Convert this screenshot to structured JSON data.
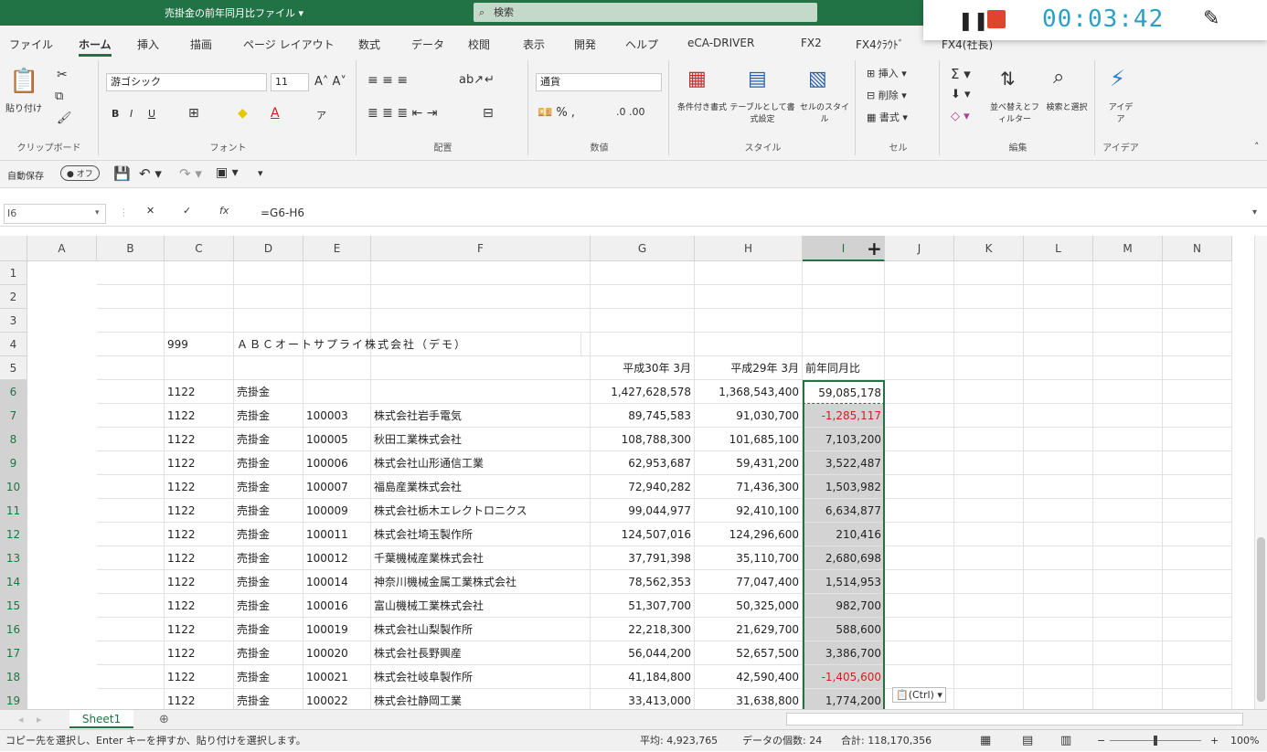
{
  "titlebar": {
    "doc_title": "売掛金の前年同月比ファイル ▾",
    "search_placeholder": "検索"
  },
  "recorder": {
    "timer": "00:03:42"
  },
  "menu": [
    "ファイル",
    "ホーム",
    "挿入",
    "描画",
    "ページ レイアウト",
    "数式",
    "データ",
    "校閲",
    "表示",
    "開発",
    "ヘルプ",
    "eCA-DRIVER",
    "FX2",
    "FX4ｸﾗｳﾄﾞ",
    "FX4(社長)"
  ],
  "ribbon": {
    "paste": "貼り付け",
    "font_name": "游ゴシック",
    "font_size": "11",
    "number_format": "通貨",
    "cond_format": "条件付き書式",
    "table_format": "テーブルとして書式設定",
    "cell_style": "セルのスタイル",
    "insert": "挿入",
    "delete": "削除",
    "format": "書式",
    "sort_filter": "並べ替えとフィルター",
    "find_select": "検索と選択",
    "ideas": "アイデア",
    "groups": [
      "クリップボード",
      "フォント",
      "配置",
      "数値",
      "スタイル",
      "セル",
      "編集",
      "アイデア"
    ]
  },
  "qat": {
    "autosave_label": "自動保存",
    "autosave_state": "オフ"
  },
  "formula_bar": {
    "name_box": "I6",
    "formula": "=G6-H6"
  },
  "columns": [
    "A",
    "B",
    "C",
    "D",
    "E",
    "F",
    "G",
    "H",
    "I",
    "J",
    "K",
    "L",
    "M",
    "N"
  ],
  "rows": [
    "1",
    "2",
    "3",
    "4",
    "5",
    "6",
    "7",
    "8",
    "9",
    "10",
    "11",
    "12",
    "13",
    "14",
    "15",
    "16",
    "17",
    "18",
    "19"
  ],
  "sheet": {
    "company_code": "999",
    "company_name": "ＡＢＣオートサプライ株式会社（デモ）",
    "header_g": "平成30年 3月",
    "header_h": "平成29年 3月",
    "header_i": "前年同月比",
    "data": [
      {
        "c": "1122",
        "d": "売掛金",
        "e": "",
        "f": "",
        "g": "1,427,628,578",
        "h": "1,368,543,400",
        "i": "59,085,178"
      },
      {
        "c": "1122",
        "d": "売掛金",
        "e": "100003",
        "f": "株式会社岩手電気",
        "g": "89,745,583",
        "h": "91,030,700",
        "i": "-1,285,117"
      },
      {
        "c": "1122",
        "d": "売掛金",
        "e": "100005",
        "f": "秋田工業株式会社",
        "g": "108,788,300",
        "h": "101,685,100",
        "i": "7,103,200"
      },
      {
        "c": "1122",
        "d": "売掛金",
        "e": "100006",
        "f": "株式会社山形通信工業",
        "g": "62,953,687",
        "h": "59,431,200",
        "i": "3,522,487"
      },
      {
        "c": "1122",
        "d": "売掛金",
        "e": "100007",
        "f": "福島産業株式会社",
        "g": "72,940,282",
        "h": "71,436,300",
        "i": "1,503,982"
      },
      {
        "c": "1122",
        "d": "売掛金",
        "e": "100009",
        "f": "株式会社栃木エレクトロニクス",
        "g": "99,044,977",
        "h": "92,410,100",
        "i": "6,634,877"
      },
      {
        "c": "1122",
        "d": "売掛金",
        "e": "100011",
        "f": "株式会社埼玉製作所",
        "g": "124,507,016",
        "h": "124,296,600",
        "i": "210,416"
      },
      {
        "c": "1122",
        "d": "売掛金",
        "e": "100012",
        "f": "千葉機械産業株式会社",
        "g": "37,791,398",
        "h": "35,110,700",
        "i": "2,680,698"
      },
      {
        "c": "1122",
        "d": "売掛金",
        "e": "100014",
        "f": "神奈川機械金属工業株式会社",
        "g": "78,562,353",
        "h": "77,047,400",
        "i": "1,514,953"
      },
      {
        "c": "1122",
        "d": "売掛金",
        "e": "100016",
        "f": "富山機械工業株式会社",
        "g": "51,307,700",
        "h": "50,325,000",
        "i": "982,700"
      },
      {
        "c": "1122",
        "d": "売掛金",
        "e": "100019",
        "f": "株式会社山梨製作所",
        "g": "22,218,300",
        "h": "21,629,700",
        "i": "588,600"
      },
      {
        "c": "1122",
        "d": "売掛金",
        "e": "100020",
        "f": "株式会社長野興産",
        "g": "56,044,200",
        "h": "52,657,500",
        "i": "3,386,700"
      },
      {
        "c": "1122",
        "d": "売掛金",
        "e": "100021",
        "f": "株式会社岐阜製作所",
        "g": "41,184,800",
        "h": "42,590,400",
        "i": "-1,405,600"
      },
      {
        "c": "1122",
        "d": "売掛金",
        "e": "100022",
        "f": "株式会社静岡工業",
        "g": "33,413,000",
        "h": "31,638,800",
        "i": "1,774,200"
      }
    ]
  },
  "paste_options": "(Ctrl) ▾",
  "sheet_tab": "Sheet1",
  "status": {
    "message": "コピー先を選択し、Enter キーを押すか、貼り付けを選択します。",
    "average": "平均: 4,923,765",
    "count": "データの個数: 24",
    "sum": "合計: 118,170,356",
    "zoom": "100%"
  }
}
